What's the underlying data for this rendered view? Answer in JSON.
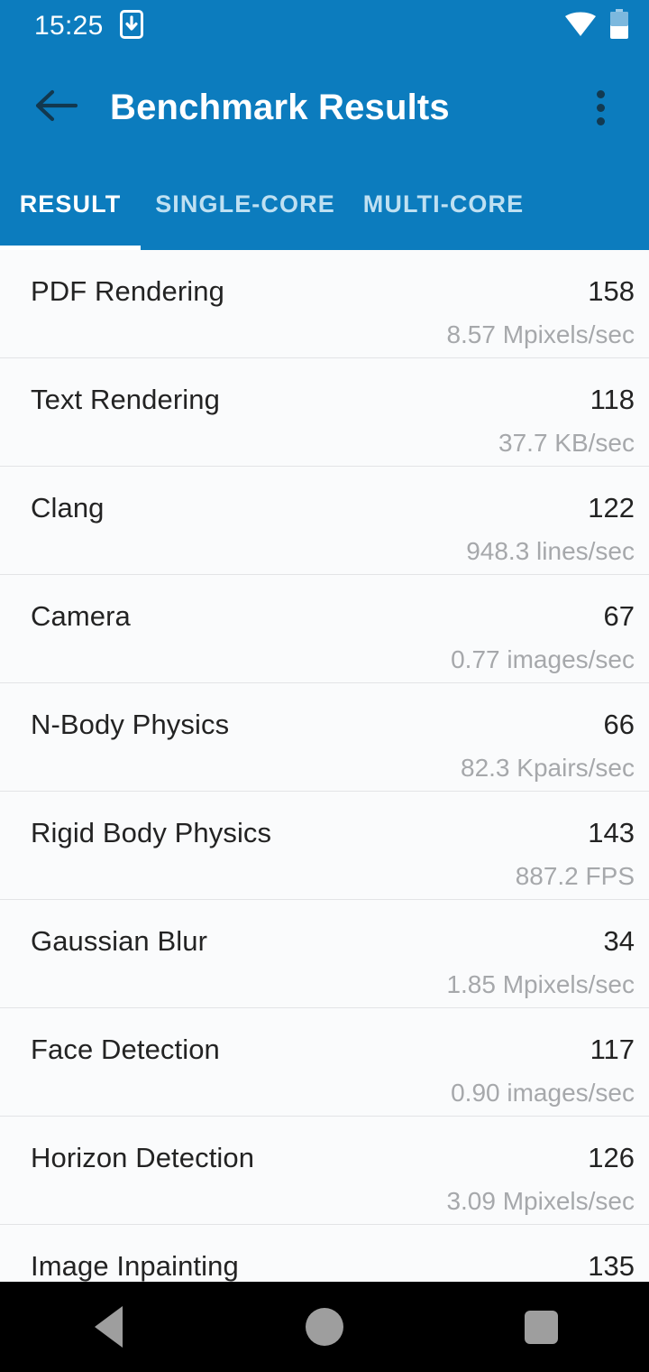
{
  "status_bar": {
    "time": "15:25",
    "icons": [
      "phone-download-icon",
      "wifi-icon",
      "battery-icon"
    ]
  },
  "app_bar": {
    "title": "Benchmark Results",
    "back_icon": "arrow-back-icon",
    "overflow_icon": "more-vert-icon"
  },
  "tabs": [
    {
      "label": "RESULT",
      "active": true
    },
    {
      "label": "SINGLE-CORE",
      "active": false
    },
    {
      "label": "MULTI-CORE",
      "active": false
    }
  ],
  "colors": {
    "primary": "#0c7cbe",
    "tab_inactive": "#bfe0f2",
    "list_background": "#fafbfc",
    "divider": "#e3e4e6",
    "score_text": "#232323",
    "subtitle_text": "#a6a8ab",
    "nav_bar": "#000000",
    "nav_icon": "#9e9e9e"
  },
  "results": [
    {
      "name": "PDF Rendering",
      "score": "158",
      "rate": "8.57 Mpixels/sec"
    },
    {
      "name": "Text Rendering",
      "score": "118",
      "rate": "37.7 KB/sec"
    },
    {
      "name": "Clang",
      "score": "122",
      "rate": "948.3 lines/sec"
    },
    {
      "name": "Camera",
      "score": "67",
      "rate": "0.77 images/sec"
    },
    {
      "name": "N-Body Physics",
      "score": "66",
      "rate": "82.3 Kpairs/sec"
    },
    {
      "name": "Rigid Body Physics",
      "score": "143",
      "rate": "887.2 FPS"
    },
    {
      "name": "Gaussian Blur",
      "score": "34",
      "rate": "1.85 Mpixels/sec"
    },
    {
      "name": "Face Detection",
      "score": "117",
      "rate": "0.90 images/sec"
    },
    {
      "name": "Horizon Detection",
      "score": "126",
      "rate": "3.09 Mpixels/sec"
    },
    {
      "name": "Image Inpainting",
      "score": "135",
      "rate": ""
    }
  ],
  "nav_bar": {
    "back_label": "back-nav",
    "home_label": "home-nav",
    "recents_label": "recents-nav"
  }
}
